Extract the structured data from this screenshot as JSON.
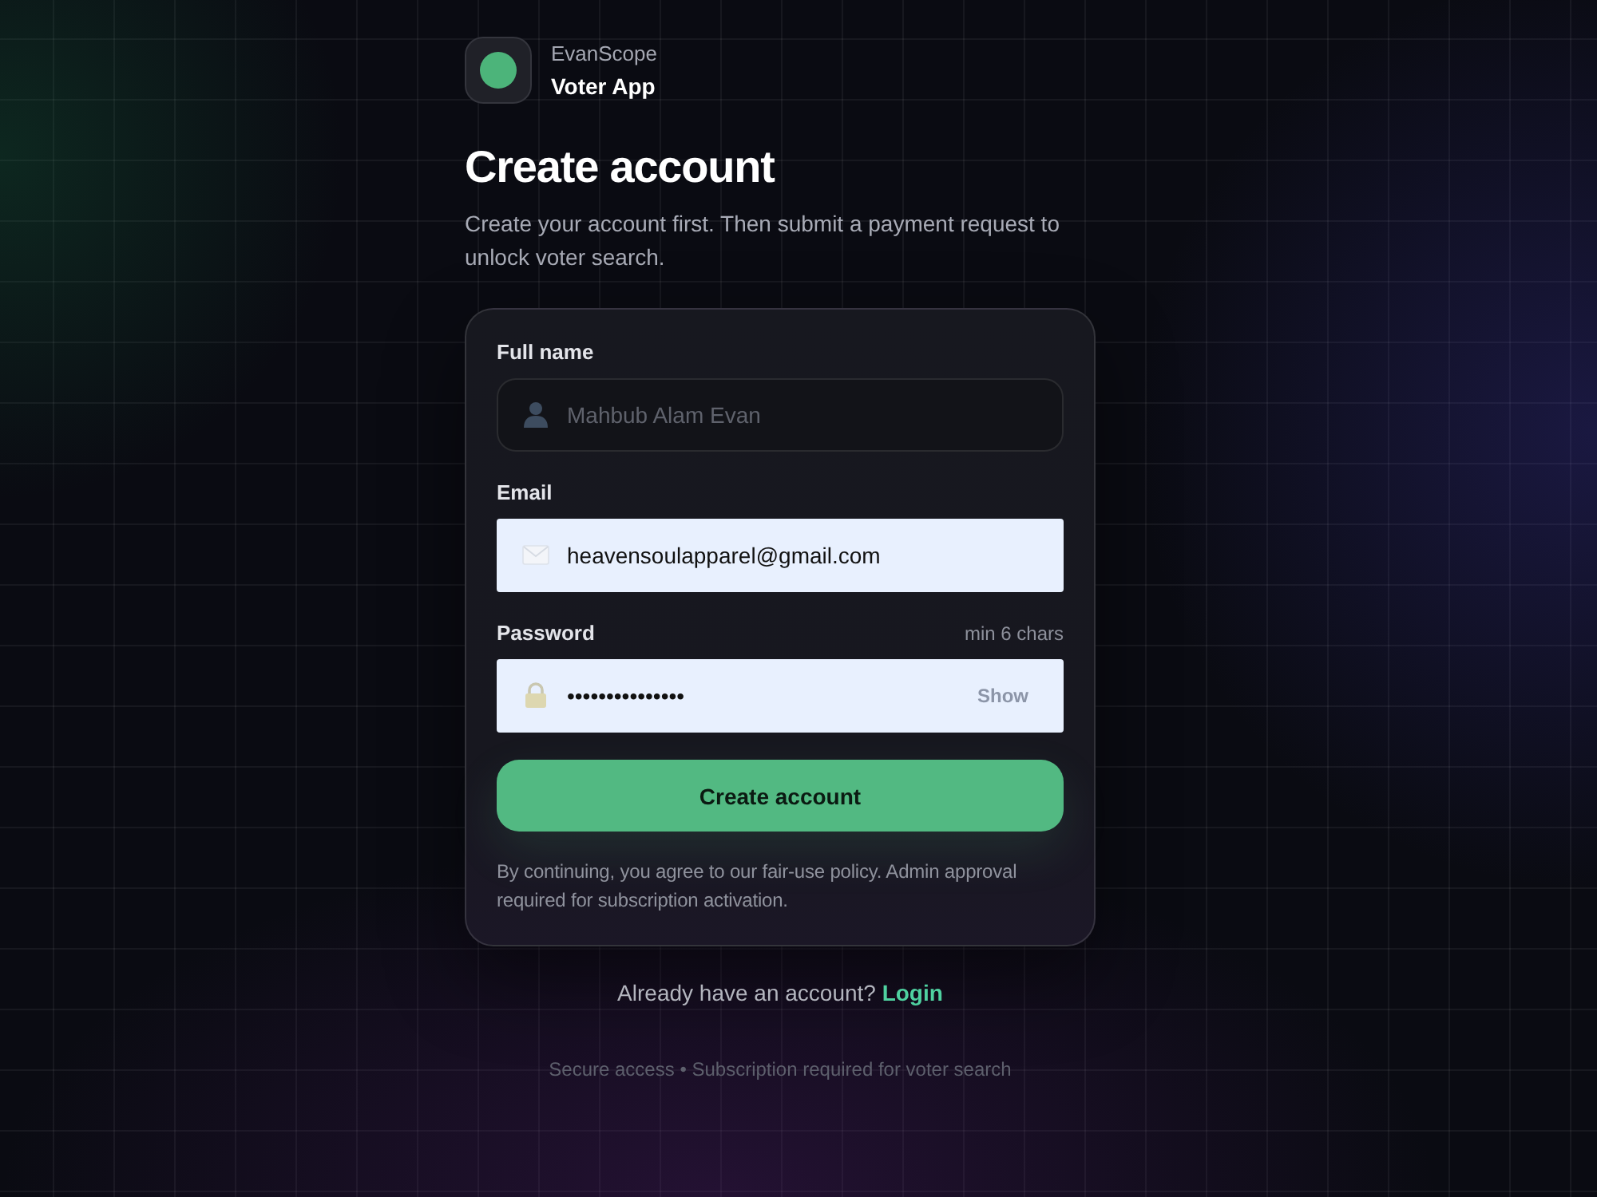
{
  "brand": {
    "name": "EvanScope",
    "app": "Voter App"
  },
  "heading": "Create account",
  "subtitle": "Create your account first. Then submit a payment request to unlock voter search.",
  "form": {
    "fields": [
      {
        "kind": "text",
        "label": "Full name",
        "placeholder": "Mahbub Alam Evan",
        "autofilled": false
      },
      {
        "kind": "email",
        "label": "Email",
        "value": "heavensoulapparel@gmail.com",
        "autofilled": true
      },
      {
        "kind": "password",
        "label": "Password",
        "hint": "min 6 chars",
        "value": "•••••••••••••••",
        "autofilled": true,
        "toggle": "Show"
      }
    ],
    "submit": "Create account",
    "note": "By continuing, you agree to our fair-use policy. Admin approval required for subscription activation."
  },
  "login_prompt": {
    "text": "Already have an account?",
    "link": "Login"
  },
  "footer": "Secure access • Subscription required for voter search"
}
